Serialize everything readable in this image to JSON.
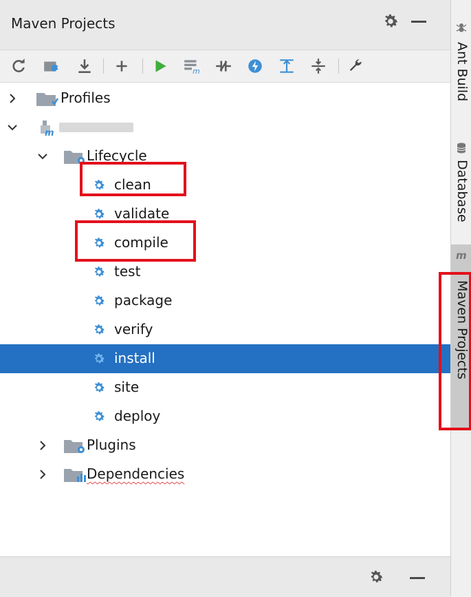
{
  "panel": {
    "title": "Maven Projects"
  },
  "toolbar": {
    "buttons": [
      {
        "name": "reimport-icon"
      },
      {
        "name": "generate-sources-icon"
      },
      {
        "name": "download-icon"
      },
      {
        "name": "add-icon"
      },
      {
        "name": "run-icon"
      },
      {
        "name": "execute-goal-icon"
      },
      {
        "name": "toggle-offline-icon"
      },
      {
        "name": "skip-tests-icon"
      },
      {
        "name": "show-dependencies-icon"
      },
      {
        "name": "collapse-all-icon"
      },
      {
        "name": "settings-wrench-icon"
      }
    ]
  },
  "tree": {
    "profiles": "Profiles",
    "project": "",
    "lifecycle": "Lifecycle",
    "goals": [
      "clean",
      "validate",
      "compile",
      "test",
      "package",
      "verify",
      "install",
      "site",
      "deploy"
    ],
    "selected_goal": "install",
    "plugins": "Plugins",
    "dependencies": "Dependencies"
  },
  "sidebar": {
    "tabs": [
      {
        "label": "Ant Build",
        "icon": "ant-icon"
      },
      {
        "label": "Database",
        "icon": "database-icon"
      },
      {
        "label": "Maven Projects",
        "icon": "maven-icon",
        "active": true
      }
    ]
  },
  "colors": {
    "selection": "#2470c2",
    "highlight_box": "#e3101b",
    "gear_blue": "#3d8fd6",
    "run_green": "#3eae3e"
  }
}
